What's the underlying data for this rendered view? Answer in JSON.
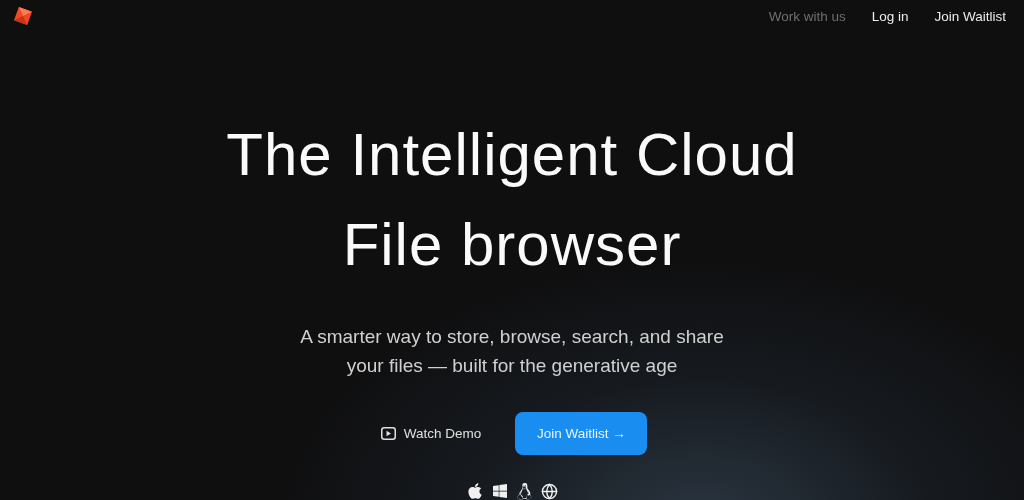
{
  "nav": {
    "links": [
      {
        "label": "Work with us",
        "dimmed": true
      },
      {
        "label": "Log in",
        "dimmed": false
      },
      {
        "label": "Join Waitlist",
        "dimmed": false
      }
    ]
  },
  "hero": {
    "title_lines": [
      "The Intelligent Cloud",
      "File browser"
    ],
    "subtitle_lines": [
      "A smarter way to store, browse, search, and share",
      "your files — built for the generative age"
    ],
    "demo_button": "Watch Demo",
    "cta_button": "Join Waitlist →",
    "platforms": [
      {
        "kind": "apple"
      },
      {
        "kind": "windows"
      },
      {
        "kind": "linux"
      },
      {
        "kind": "web"
      }
    ]
  }
}
